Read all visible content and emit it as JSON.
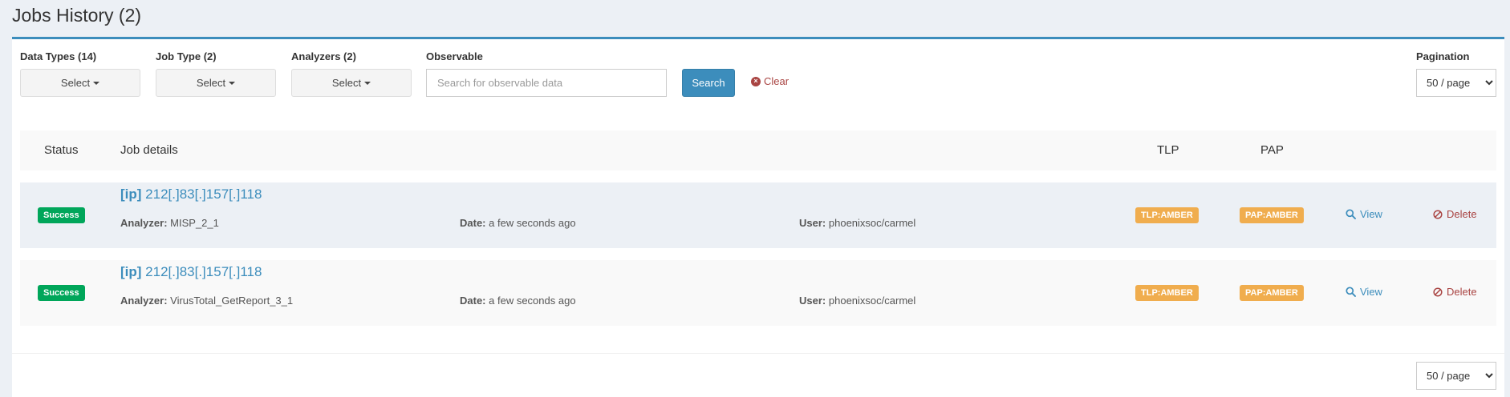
{
  "page": {
    "title": "Jobs History (2)"
  },
  "filters": {
    "data_types_label": "Data Types (14)",
    "job_type_label": "Job Type (2)",
    "analyzers_label": "Analyzers (2)",
    "observable_label": "Observable",
    "select_text": "Select",
    "observable_placeholder": "Search for observable data",
    "search_button": "Search",
    "clear_link": "Clear",
    "pagination_label": "Pagination",
    "page_size": "50 / page"
  },
  "table": {
    "headers": {
      "status": "Status",
      "job_details": "Job details",
      "tlp": "TLP",
      "pap": "PAP"
    },
    "labels": {
      "analyzer": "Analyzer:",
      "date": "Date:",
      "user": "User:",
      "view": "View",
      "delete": "Delete"
    },
    "rows": [
      {
        "status": "Success",
        "type": "[ip]",
        "observable": "212[.]83[.]157[.]118",
        "analyzer": "MISP_2_1",
        "date": "a few seconds ago",
        "user": "phoenixsoc/carmel",
        "tlp": "TLP:AMBER",
        "pap": "PAP:AMBER"
      },
      {
        "status": "Success",
        "type": "[ip]",
        "observable": "212[.]83[.]157[.]118",
        "analyzer": "VirusTotal_GetReport_3_1",
        "date": "a few seconds ago",
        "user": "phoenixsoc/carmel",
        "tlp": "TLP:AMBER",
        "pap": "PAP:AMBER"
      }
    ]
  },
  "colors": {
    "primary": "#3c8dbc",
    "success": "#00a65a",
    "amber": "#f0ad4e",
    "danger": "#a94442"
  }
}
